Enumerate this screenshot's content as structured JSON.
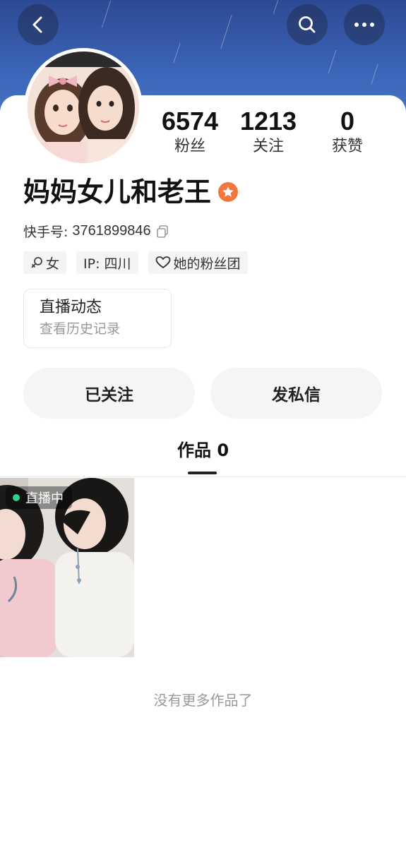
{
  "header": {
    "back_icon": "chevron-left-icon",
    "search_icon": "search-icon",
    "more_icon": "more-horizontal-icon"
  },
  "profile": {
    "name": "妈妈女儿和老王",
    "kid_label": "快手号:",
    "kid_value": "3761899846",
    "stats": [
      {
        "value": "6574",
        "label": "粉丝"
      },
      {
        "value": "1213",
        "label": "关注"
      },
      {
        "value": "0",
        "label": "获赞"
      }
    ],
    "tags": {
      "gender": "女",
      "ip": "IP: 四川",
      "fan_group": "她的粉丝团"
    }
  },
  "live_card": {
    "title": "直播动态",
    "subtitle": "查看历史记录"
  },
  "actions": {
    "follow": "已关注",
    "message": "发私信"
  },
  "tabs": {
    "works": "作品 0"
  },
  "works": {
    "live_badge": "直播中",
    "no_more": "没有更多作品了"
  },
  "colors": {
    "header_blue": "#3a63b6",
    "badge_orange": "#f0783c",
    "live_green": "#2fd28a"
  }
}
